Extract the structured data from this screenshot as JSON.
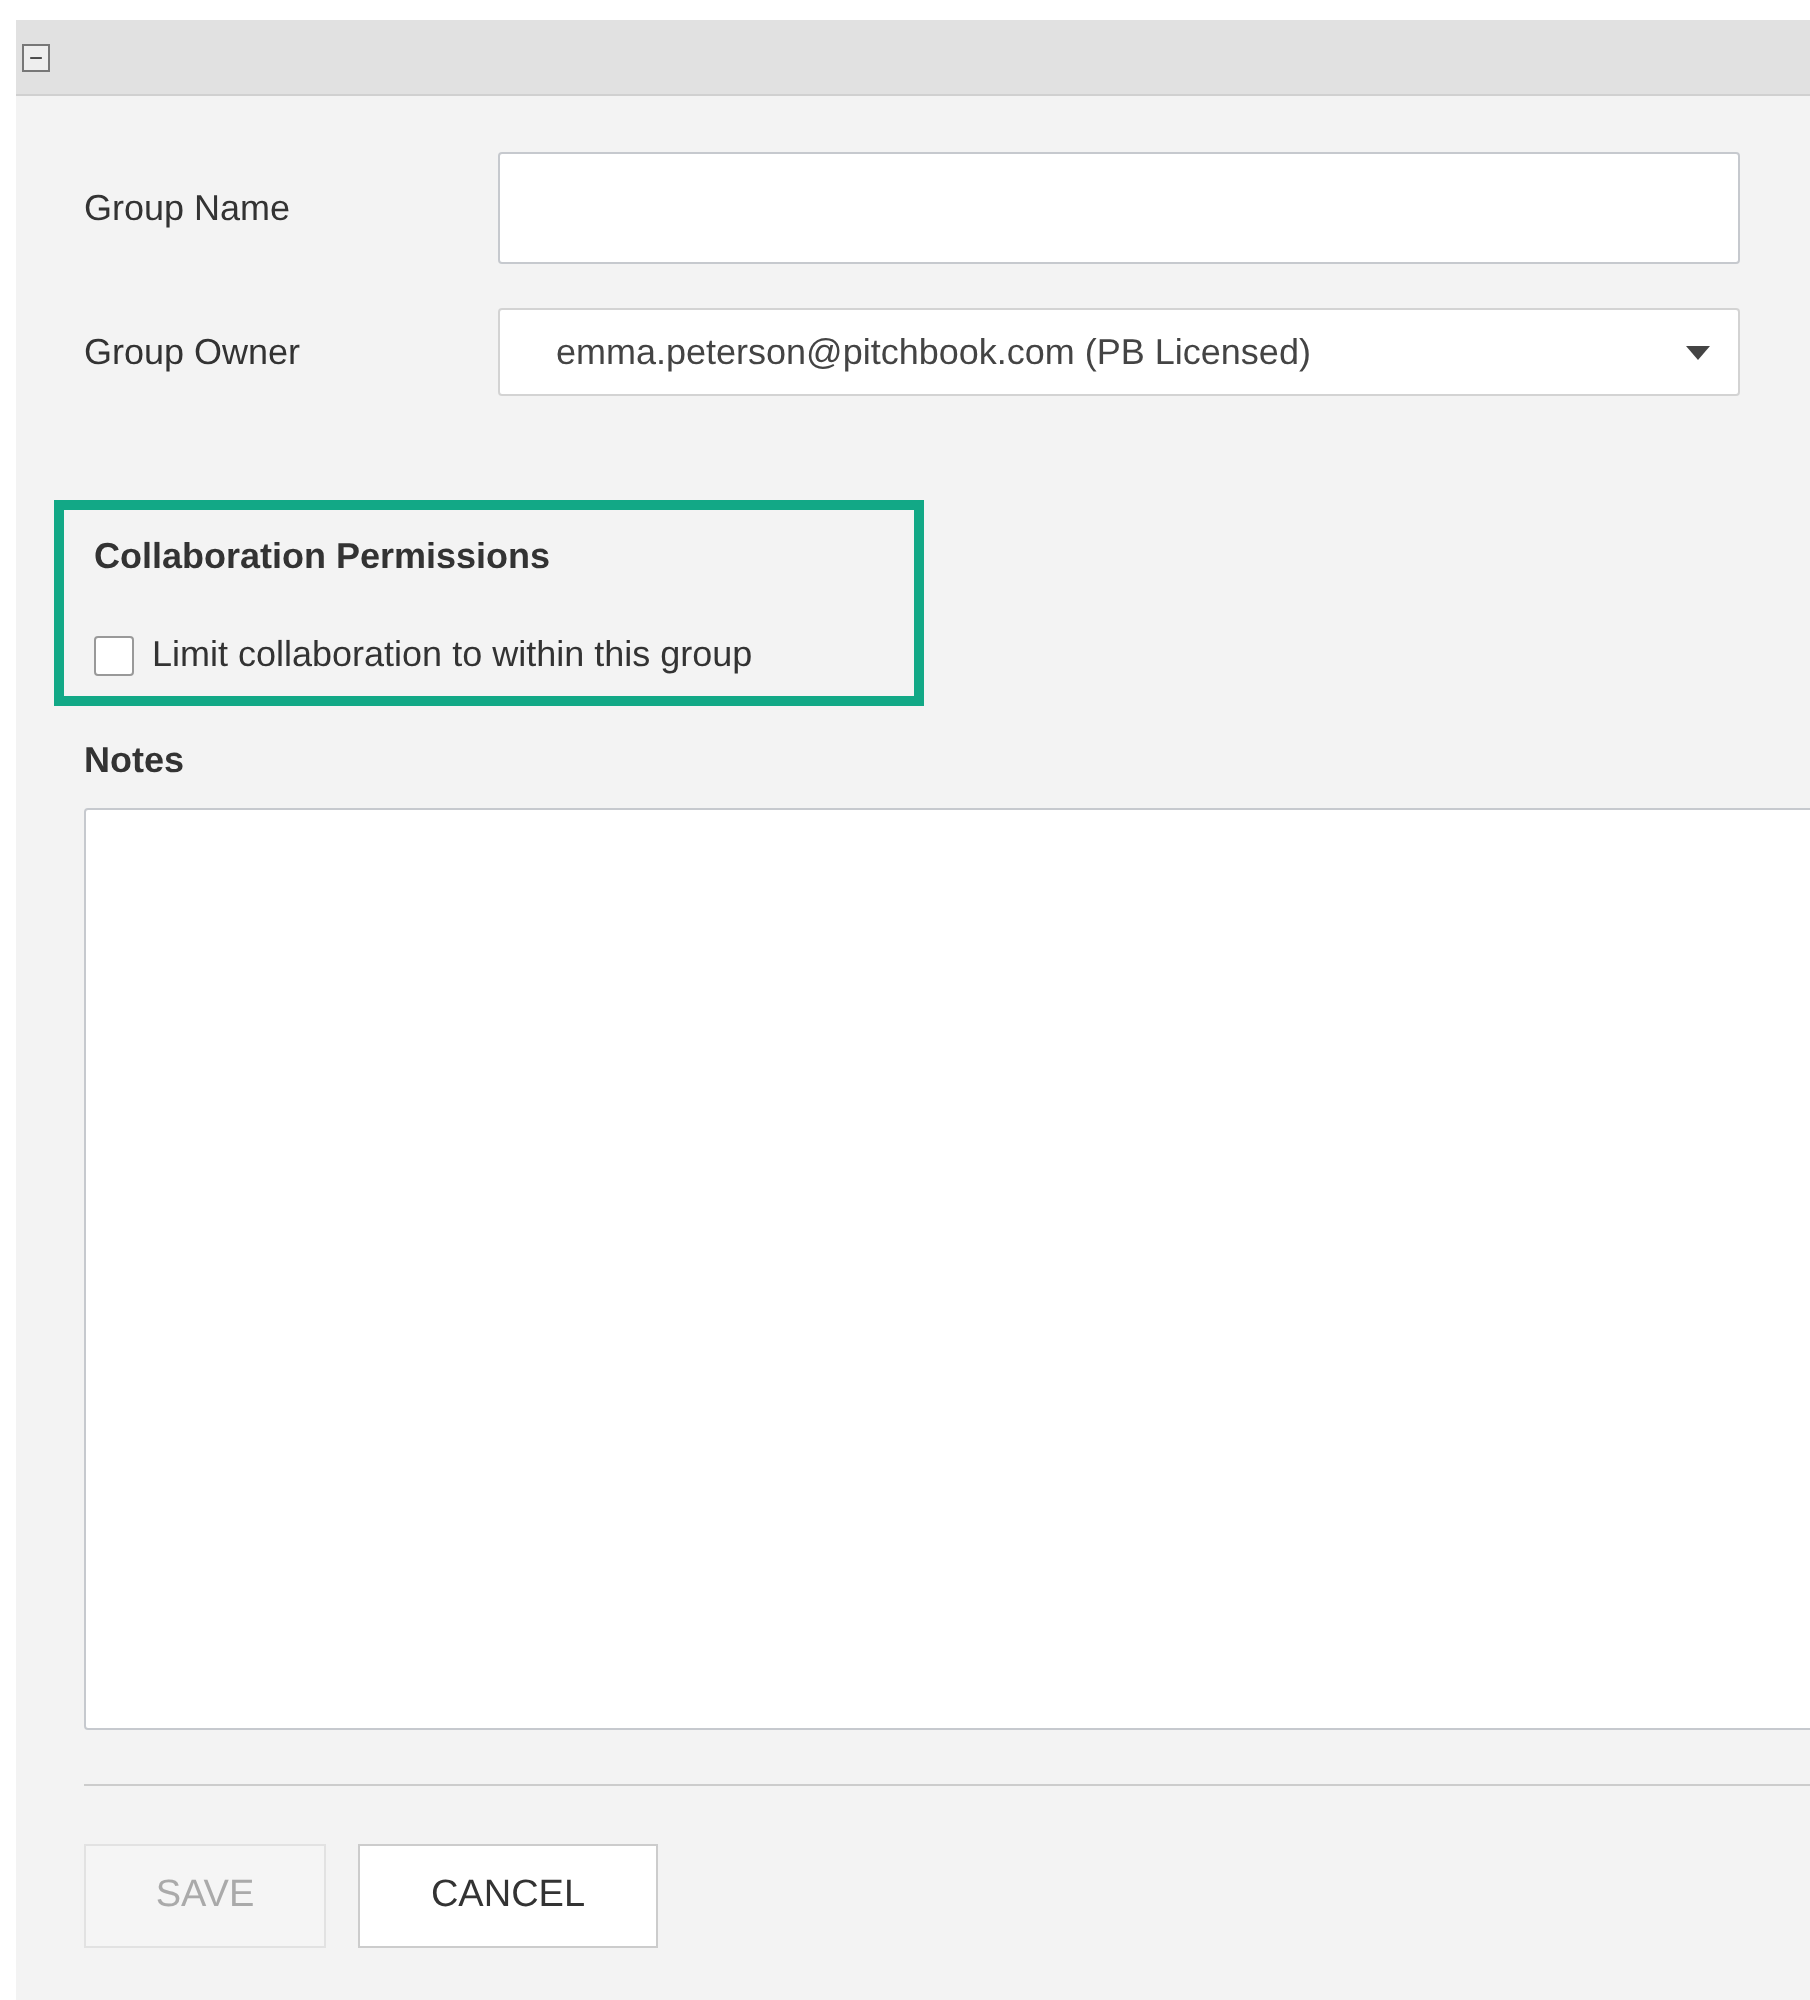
{
  "header": {
    "collapse_icon": "−"
  },
  "fields": [
    {
      "kind": "text",
      "label": "Group Name"
    },
    {
      "kind": "select",
      "label": "Group Owner",
      "value": "emma.peterson@pitchbook.com (PB Licensed)"
    }
  ],
  "collaboration_permissions": {
    "title": "Collaboration Permissions",
    "highlighted": true,
    "option": {
      "label": "Limit collaboration to within this group",
      "checked": false
    }
  },
  "notes": {
    "label": "Notes"
  },
  "buttons": [
    {
      "label": "SAVE",
      "disabled": true
    },
    {
      "label": "CANCEL",
      "disabled": false
    }
  ]
}
